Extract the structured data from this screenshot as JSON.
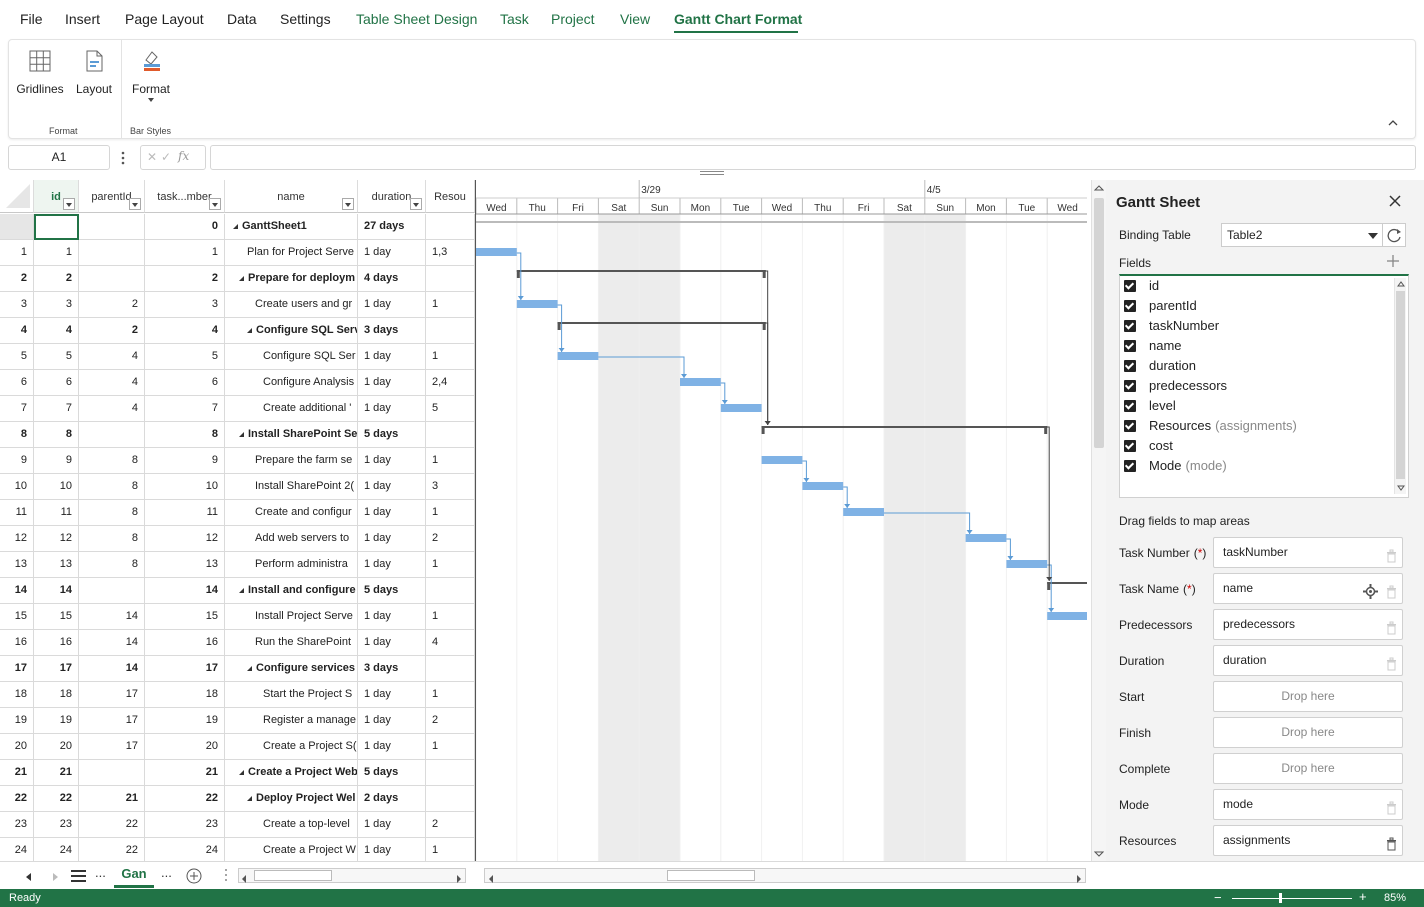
{
  "menu": {
    "items": [
      "File",
      "Insert",
      "Page Layout",
      "Data",
      "Settings",
      "Table Sheet Design",
      "Task",
      "Project",
      "View",
      "Gantt Chart Format"
    ],
    "active": "Gantt Chart Format"
  },
  "ribbon": {
    "gridlines": "Gridlines",
    "layout": "Layout",
    "format": "Format",
    "group_format": "Format",
    "group_bar_styles": "Bar Styles"
  },
  "formula_bar": {
    "name_box": "A1",
    "fx": "fx",
    "formula": ""
  },
  "grid": {
    "headers": [
      "id",
      "parentId",
      "task...mber",
      "name",
      "duration",
      "Resou"
    ],
    "rows": [
      {
        "rn": "",
        "id": "",
        "pid": "",
        "tn": "0",
        "name": "GanttSheet1",
        "dur": "27 days",
        "res": "",
        "bold": true,
        "lvl": 0,
        "sum": true
      },
      {
        "rn": "1",
        "id": "1",
        "pid": "",
        "tn": "1",
        "name": "Plan for Project Serve",
        "dur": "1 day",
        "res": "1,3",
        "bold": false,
        "lvl": 1,
        "sum": false
      },
      {
        "rn": "2",
        "id": "2",
        "pid": "",
        "tn": "2",
        "name": "Prepare for deploym",
        "dur": "4 days",
        "res": "",
        "bold": true,
        "lvl": 1,
        "sum": true
      },
      {
        "rn": "3",
        "id": "3",
        "pid": "2",
        "tn": "3",
        "name": "Create users and gr",
        "dur": "1 day",
        "res": "1",
        "bold": false,
        "lvl": 2,
        "sum": false
      },
      {
        "rn": "4",
        "id": "4",
        "pid": "2",
        "tn": "4",
        "name": "Configure SQL Serv",
        "dur": "3 days",
        "res": "",
        "bold": true,
        "lvl": 2,
        "sum": true
      },
      {
        "rn": "5",
        "id": "5",
        "pid": "4",
        "tn": "5",
        "name": "Configure SQL Ser",
        "dur": "1 day",
        "res": "1",
        "bold": false,
        "lvl": 3,
        "sum": false
      },
      {
        "rn": "6",
        "id": "6",
        "pid": "4",
        "tn": "6",
        "name": "Configure Analysis",
        "dur": "1 day",
        "res": "2,4",
        "bold": false,
        "lvl": 3,
        "sum": false
      },
      {
        "rn": "7",
        "id": "7",
        "pid": "4",
        "tn": "7",
        "name": "Create additional '",
        "dur": "1 day",
        "res": "5",
        "bold": false,
        "lvl": 3,
        "sum": false
      },
      {
        "rn": "8",
        "id": "8",
        "pid": "",
        "tn": "8",
        "name": "Install SharePoint Se",
        "dur": "5 days",
        "res": "",
        "bold": true,
        "lvl": 1,
        "sum": true
      },
      {
        "rn": "9",
        "id": "9",
        "pid": "8",
        "tn": "9",
        "name": "Prepare the farm se",
        "dur": "1 day",
        "res": "1",
        "bold": false,
        "lvl": 2,
        "sum": false
      },
      {
        "rn": "10",
        "id": "10",
        "pid": "8",
        "tn": "10",
        "name": "Install SharePoint 2(",
        "dur": "1 day",
        "res": "3",
        "bold": false,
        "lvl": 2,
        "sum": false
      },
      {
        "rn": "11",
        "id": "11",
        "pid": "8",
        "tn": "11",
        "name": "Create and configur",
        "dur": "1 day",
        "res": "1",
        "bold": false,
        "lvl": 2,
        "sum": false
      },
      {
        "rn": "12",
        "id": "12",
        "pid": "8",
        "tn": "12",
        "name": "Add web servers to",
        "dur": "1 day",
        "res": "2",
        "bold": false,
        "lvl": 2,
        "sum": false
      },
      {
        "rn": "13",
        "id": "13",
        "pid": "8",
        "tn": "13",
        "name": "Perform administra",
        "dur": "1 day",
        "res": "1",
        "bold": false,
        "lvl": 2,
        "sum": false
      },
      {
        "rn": "14",
        "id": "14",
        "pid": "",
        "tn": "14",
        "name": "Install and configure",
        "dur": "5 days",
        "res": "",
        "bold": true,
        "lvl": 1,
        "sum": true
      },
      {
        "rn": "15",
        "id": "15",
        "pid": "14",
        "tn": "15",
        "name": "Install Project Serve",
        "dur": "1 day",
        "res": "1",
        "bold": false,
        "lvl": 2,
        "sum": false
      },
      {
        "rn": "16",
        "id": "16",
        "pid": "14",
        "tn": "16",
        "name": "Run the SharePoint",
        "dur": "1 day",
        "res": "4",
        "bold": false,
        "lvl": 2,
        "sum": false
      },
      {
        "rn": "17",
        "id": "17",
        "pid": "14",
        "tn": "17",
        "name": "Configure services",
        "dur": "3 days",
        "res": "",
        "bold": true,
        "lvl": 2,
        "sum": true
      },
      {
        "rn": "18",
        "id": "18",
        "pid": "17",
        "tn": "18",
        "name": "Start the Project S",
        "dur": "1 day",
        "res": "1",
        "bold": false,
        "lvl": 3,
        "sum": false
      },
      {
        "rn": "19",
        "id": "19",
        "pid": "17",
        "tn": "19",
        "name": "Register a manage",
        "dur": "1 day",
        "res": "2",
        "bold": false,
        "lvl": 3,
        "sum": false
      },
      {
        "rn": "20",
        "id": "20",
        "pid": "17",
        "tn": "20",
        "name": "Create a Project S(",
        "dur": "1 day",
        "res": "1",
        "bold": false,
        "lvl": 3,
        "sum": false
      },
      {
        "rn": "21",
        "id": "21",
        "pid": "",
        "tn": "21",
        "name": "Create a Project Web",
        "dur": "5 days",
        "res": "",
        "bold": true,
        "lvl": 1,
        "sum": true
      },
      {
        "rn": "22",
        "id": "22",
        "pid": "21",
        "tn": "22",
        "name": "Deploy Project Wel",
        "dur": "2 days",
        "res": "",
        "bold": true,
        "lvl": 2,
        "sum": true
      },
      {
        "rn": "23",
        "id": "23",
        "pid": "22",
        "tn": "23",
        "name": "Create a top-level",
        "dur": "1 day",
        "res": "2",
        "bold": false,
        "lvl": 3,
        "sum": false
      },
      {
        "rn": "24",
        "id": "24",
        "pid": "22",
        "tn": "24",
        "name": "Create a Project W",
        "dur": "1 day",
        "res": "1",
        "bold": false,
        "lvl": 3,
        "sum": false
      }
    ]
  },
  "gantt": {
    "week_labels": [
      "3/29",
      "4/5"
    ],
    "days": [
      "Wed",
      "Thu",
      "Fri",
      "Sat",
      "Sun",
      "Mon",
      "Tue",
      "Wed",
      "Thu",
      "Fri",
      "Sat",
      "Sun",
      "Mon",
      "Tue",
      "Wed"
    ],
    "weekend_idx": [
      3,
      4,
      10,
      11
    ],
    "bars": [
      {
        "row": 1,
        "start": 0,
        "len": 1,
        "type": "task"
      },
      {
        "row": 2,
        "start": 1,
        "len": 6.1,
        "type": "summary"
      },
      {
        "row": 3,
        "start": 1,
        "len": 1,
        "type": "task"
      },
      {
        "row": 4,
        "start": 2,
        "len": 5.1,
        "type": "summary"
      },
      {
        "row": 5,
        "start": 2,
        "len": 1,
        "type": "task"
      },
      {
        "row": 6,
        "start": 5,
        "len": 1,
        "type": "task"
      },
      {
        "row": 7,
        "start": 6,
        "len": 1,
        "type": "task"
      },
      {
        "row": 8,
        "start": 7,
        "len": 7,
        "type": "summary"
      },
      {
        "row": 9,
        "start": 7,
        "len": 1,
        "type": "task"
      },
      {
        "row": 10,
        "start": 8,
        "len": 1,
        "type": "task"
      },
      {
        "row": 11,
        "start": 9,
        "len": 1,
        "type": "task"
      },
      {
        "row": 12,
        "start": 12,
        "len": 1,
        "type": "task"
      },
      {
        "row": 13,
        "start": 13,
        "len": 1,
        "type": "task"
      },
      {
        "row": 14,
        "start": 14,
        "len": 1.2,
        "type": "summary"
      },
      {
        "row": 15,
        "start": 14,
        "len": 1.2,
        "type": "task"
      }
    ]
  },
  "panel": {
    "title": "Gantt Sheet",
    "binding_label": "Binding Table",
    "binding_value": "Table2",
    "fields_label": "Fields",
    "fields": [
      {
        "name": "id",
        "alias": ""
      },
      {
        "name": "parentId",
        "alias": ""
      },
      {
        "name": "taskNumber",
        "alias": ""
      },
      {
        "name": "name",
        "alias": ""
      },
      {
        "name": "duration",
        "alias": ""
      },
      {
        "name": "predecessors",
        "alias": ""
      },
      {
        "name": "level",
        "alias": ""
      },
      {
        "name": "Resources",
        "alias": "(assignments)"
      },
      {
        "name": "cost",
        "alias": ""
      },
      {
        "name": "Mode",
        "alias": "(mode)"
      }
    ],
    "drag_hint": "Drag fields to map areas",
    "mappings": [
      {
        "label": "Task Number",
        "req": "(*)",
        "value": "taskNumber",
        "drop": false,
        "gear": false
      },
      {
        "label": "Task Name",
        "req": "(*)",
        "value": "name",
        "drop": false,
        "gear": true
      },
      {
        "label": "Predecessors",
        "req": "",
        "value": "predecessors",
        "drop": false,
        "gear": false
      },
      {
        "label": "Duration",
        "req": "",
        "value": "duration",
        "drop": false,
        "gear": false
      },
      {
        "label": "Start",
        "req": "",
        "value": "Drop here",
        "drop": true,
        "gear": false
      },
      {
        "label": "Finish",
        "req": "",
        "value": "Drop here",
        "drop": true,
        "gear": false
      },
      {
        "label": "Complete",
        "req": "",
        "value": "Drop here",
        "drop": true,
        "gear": false
      },
      {
        "label": "Mode",
        "req": "",
        "value": "mode",
        "drop": false,
        "gear": false
      },
      {
        "label": "Resources",
        "req": "",
        "value": "assignments",
        "drop": false,
        "gear": false
      }
    ]
  },
  "tabs": {
    "sheet_tab": "Gan",
    "more": "..."
  },
  "status": {
    "ready": "Ready",
    "zoom": "85%"
  },
  "colors": {
    "accent": "#217346",
    "bar": "#7fb2e5",
    "summary": "#555555",
    "link": "#5b9bd5"
  }
}
